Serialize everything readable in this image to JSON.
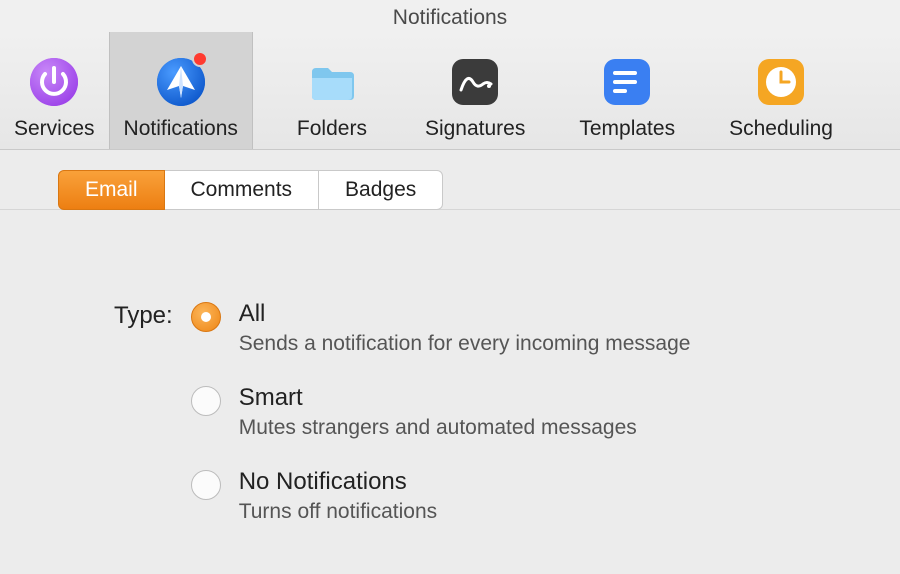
{
  "window": {
    "title": "Notifications"
  },
  "toolbar": {
    "items": [
      {
        "label": "Services"
      },
      {
        "label": "Notifications"
      },
      {
        "label": "Folders"
      },
      {
        "label": "Signatures"
      },
      {
        "label": "Templates"
      },
      {
        "label": "Scheduling"
      }
    ],
    "active_index": 1
  },
  "subtabs": {
    "items": [
      {
        "label": "Email"
      },
      {
        "label": "Comments"
      },
      {
        "label": "Badges"
      }
    ],
    "active_index": 0
  },
  "type_section": {
    "label": "Type:",
    "selected_index": 0,
    "options": [
      {
        "title": "All",
        "desc": "Sends a notification for every incoming message"
      },
      {
        "title": "Smart",
        "desc": "Mutes strangers and automated messages"
      },
      {
        "title": "No Notifications",
        "desc": "Turns off notifications"
      }
    ]
  }
}
